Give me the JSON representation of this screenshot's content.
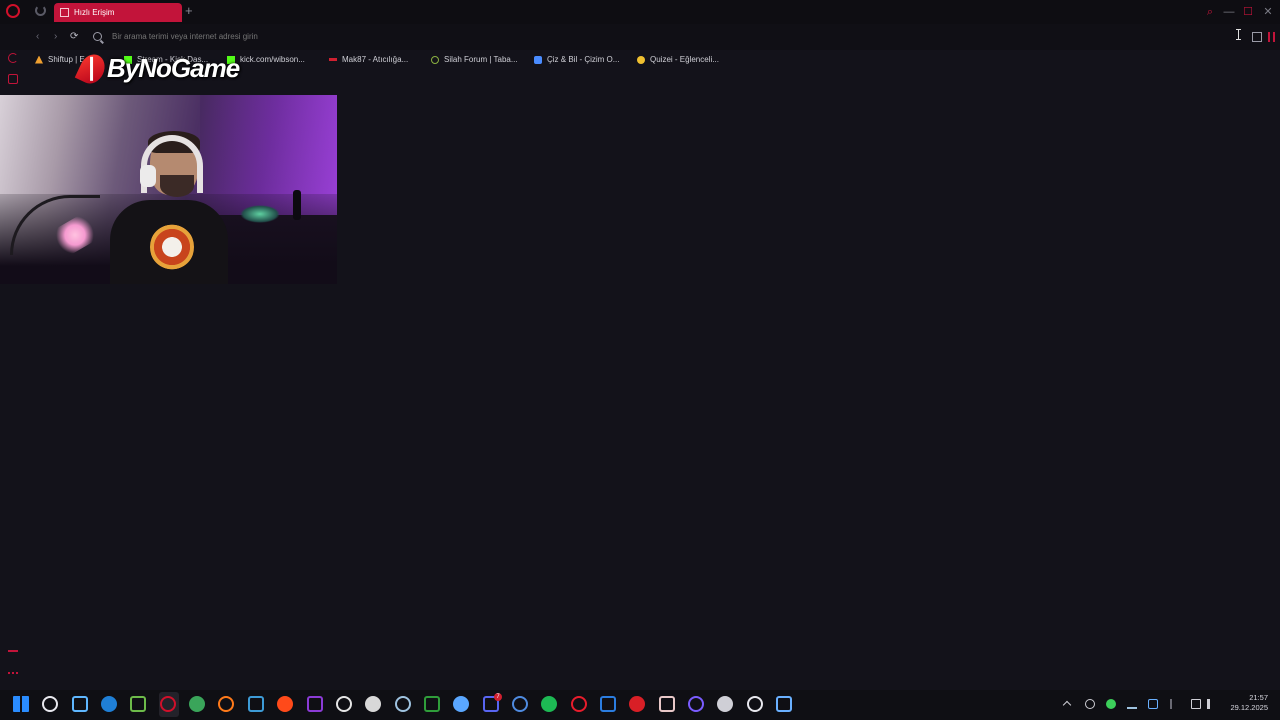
{
  "browser": {
    "active_tab_label": "Hızlı Erişim",
    "new_tab_symbol": "+",
    "address_placeholder": "Bir arama terimi veya internet adresi girin",
    "window_controls": {
      "minimize": "—",
      "maximize": "☐",
      "close": "✕"
    }
  },
  "bookmarks": [
    {
      "label": "Shiftup | E...",
      "icon": "flame-icon",
      "color": "#f0a030"
    },
    {
      "label": "Stream - Kick Das...",
      "icon": "kick-icon",
      "color": "#53fc18"
    },
    {
      "label": "kick.com/wibson...",
      "icon": "kick-icon",
      "color": "#53fc18"
    },
    {
      "label": "Mak87 - Atıcılığa...",
      "icon": "bookmark-icon",
      "color": "#d02030"
    },
    {
      "label": "Silah Forum | Taba...",
      "icon": "globe-icon",
      "color": "#8ab040"
    },
    {
      "label": "Çiz & Bil - Çizim O...",
      "icon": "cp-icon",
      "color": "#4a8cff"
    },
    {
      "label": "Quizei - Eğlenceli...",
      "icon": "quiz-icon",
      "color": "#f0c030"
    }
  ],
  "overlay": {
    "logo_text": "ByNoGame"
  },
  "taskbar": {
    "apps": [
      {
        "name": "windows-start-icon",
        "color": "#2a8cff"
      },
      {
        "name": "task-view-icon",
        "color": "#e8e8ee"
      },
      {
        "name": "copilot-icon",
        "color": "#5fb7ff"
      },
      {
        "name": "store-icon",
        "color": "#1f7fd6"
      },
      {
        "name": "xbox-icon",
        "color": "#6dbb4a"
      },
      {
        "name": "opera-icon",
        "color": "#d0102a"
      },
      {
        "name": "chrome-icon",
        "color": "#3aa55a"
      },
      {
        "name": "firefox-icon",
        "color": "#ff7a1a"
      },
      {
        "name": "desktop-icon",
        "color": "#3d9bd6"
      },
      {
        "name": "ea-icon",
        "color": "#ff4a1a"
      },
      {
        "name": "circle-app-icon",
        "color": "#8b3bd6"
      },
      {
        "name": "amazon-icon",
        "color": "#e6e6e6"
      },
      {
        "name": "epic-games-icon",
        "color": "#d8d8d8"
      },
      {
        "name": "steam-icon",
        "color": "#9fc3e0"
      },
      {
        "name": "xbox-app-icon",
        "color": "#2f9d3a"
      },
      {
        "name": "battlenet-icon",
        "color": "#5aa7ff"
      },
      {
        "name": "discord-icon",
        "color": "#5865f2"
      },
      {
        "name": "ubisoft-icon",
        "color": "#4f8be0"
      },
      {
        "name": "spotify-icon",
        "color": "#1db954"
      },
      {
        "name": "youtube-music-icon",
        "color": "#e81c2c"
      },
      {
        "name": "ms-app-icon",
        "color": "#2b7de0"
      },
      {
        "name": "netflix-icon",
        "color": "#d81f26"
      },
      {
        "name": "popcorn-icon",
        "color": "#e8c8c8"
      },
      {
        "name": "arrow-app-icon",
        "color": "#7a5cff"
      },
      {
        "name": "obs-icon",
        "color": "#cfcfd6"
      },
      {
        "name": "chatgpt-icon",
        "color": "#e8e8ee"
      },
      {
        "name": "gear-app-icon",
        "color": "#6ab0ff"
      }
    ],
    "discord_badge": "7",
    "time": "21:57",
    "date": "29.12.2025"
  }
}
